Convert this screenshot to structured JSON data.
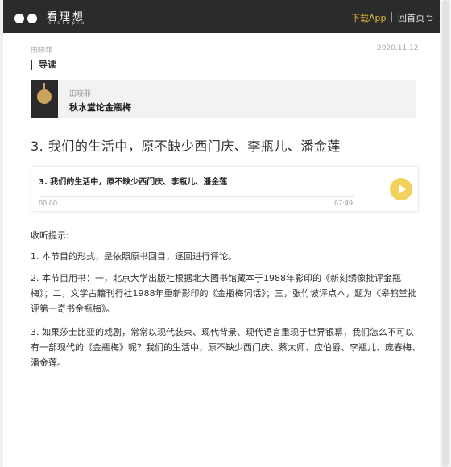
{
  "header": {
    "logo_text": "看理想",
    "logo_sub": "vistopia",
    "download_label": "下载App",
    "home_label": "回首页",
    "home_icon": "return-icon"
  },
  "meta": {
    "author": "田晓菲",
    "date": "2020.11.12"
  },
  "guide": {
    "label": "导读"
  },
  "course": {
    "author": "田晓菲",
    "title": "秋水堂论金瓶梅"
  },
  "episode": {
    "title": "3. 我们的生活中，原不缺少西门庆、李瓶儿、潘金莲"
  },
  "player": {
    "title": "3. 我们的生活中，原不缺少西门庆、李瓶儿、潘金莲",
    "time_current": "00:00",
    "time_total": "07:49",
    "progress": 0,
    "accent": "#f2d25c"
  },
  "tips": {
    "heading": "收听提示:",
    "items": [
      "1. 本节目的形式，是依照原书回目，逐回进行评论。",
      "2. 本节目用书：一，北京大学出版社根据北大图书馆藏本于1988年影印的《新刻绣像批评金瓶梅》；二，文学古籍刊行社1988年重新影印的《金瓶梅词话》；三，张竹坡评点本，题为《皋鹤堂批评第一奇书金瓶梅》。",
      "3. 如果莎士比亚的戏剧，常常以现代装束、现代背景、现代语言重现于世界银幕，我们怎么不可以有一部现代的《金瓶梅》呢？我们的生活中，原不缺少西门庆、蔡太师、应伯爵、李瓶儿、庞春梅、潘金莲。"
    ]
  },
  "colors": {
    "header_bg": "#2b2b2b",
    "download_link": "#e0b83a"
  }
}
